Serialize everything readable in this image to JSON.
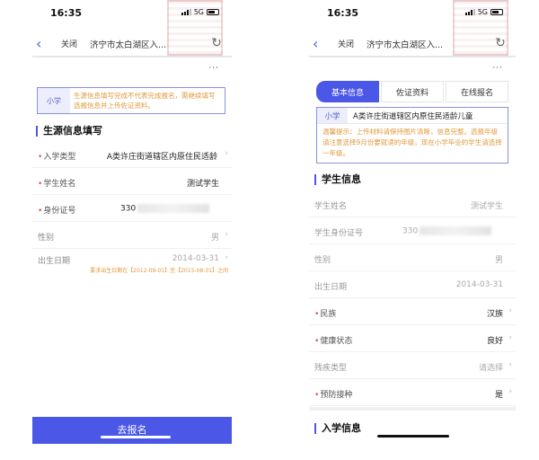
{
  "status_bar": {
    "time": "16:35",
    "network": "5G"
  },
  "navbar": {
    "back_icon": "chevron-left-icon",
    "close_label": "关闭",
    "title": "济宁市太白湖区入...",
    "refresh_icon": "refresh-icon",
    "more_label": "···"
  },
  "left_screen": {
    "notice": {
      "tag": "小学",
      "text": "生源信息填写完成不代表完成报名，需继续填写选报信息并上传佐证资料。"
    },
    "section_title": "生源信息填写",
    "fields": [
      {
        "label": "入学类型",
        "required": true,
        "value": "A类许庄街道辖区内原住民适龄",
        "chevron": true
      },
      {
        "label": "学生姓名",
        "required": true,
        "value": "测试学生",
        "chevron": false
      },
      {
        "label": "身份证号",
        "required": true,
        "value": "330",
        "chevron": false,
        "redacted": true
      },
      {
        "label": "性别",
        "required": false,
        "value": "男",
        "chevron": true
      },
      {
        "label": "出生日期",
        "required": false,
        "value": "2014-03-31",
        "chevron": true
      }
    ],
    "birth_hint": "要求出生日期在【2012-09-01】至【2015-08-31】之间",
    "submit_label": "去报名"
  },
  "right_screen": {
    "steps": [
      {
        "label": "基本信息",
        "active": true
      },
      {
        "label": "佐证资料",
        "active": false
      },
      {
        "label": "在线报名",
        "active": false
      }
    ],
    "notice": {
      "tag": "小学",
      "category": "A类许庄街道辖区内原住民适龄儿童",
      "text": "温馨提示：上传材料请保持图片清晰，信息完整。选报年级请注意选择9月份要就读的年级，现在小学毕业的学生请选择一年级。"
    },
    "student_section_title": "学生信息",
    "fields": [
      {
        "label": "学生姓名",
        "required": false,
        "value": "测试学生",
        "chevron": false,
        "muted": true
      },
      {
        "label": "学生身份证号",
        "required": false,
        "value": "330",
        "chevron": false,
        "muted": true,
        "redacted": true
      },
      {
        "label": "性别",
        "required": false,
        "value": "男",
        "chevron": false,
        "muted": true
      },
      {
        "label": "出生日期",
        "required": false,
        "value": "2014-03-31",
        "chevron": false,
        "muted": true
      },
      {
        "label": "民族",
        "required": true,
        "value": "汉族",
        "chevron": true,
        "muted": false
      },
      {
        "label": "健康状态",
        "required": true,
        "value": "良好",
        "chevron": true,
        "muted": false
      },
      {
        "label": "残疾类型",
        "required": false,
        "value": "请选择",
        "chevron": true,
        "muted": true,
        "placeholder": true
      },
      {
        "label": "预防接种",
        "required": true,
        "value": "是",
        "chevron": true,
        "muted": false
      }
    ],
    "enroll_section_title": "入学信息"
  },
  "colors": {
    "accent": "#4b57e6",
    "warning_text": "#e0993a",
    "required": "#e05050",
    "link_blue": "#3b66d6"
  }
}
